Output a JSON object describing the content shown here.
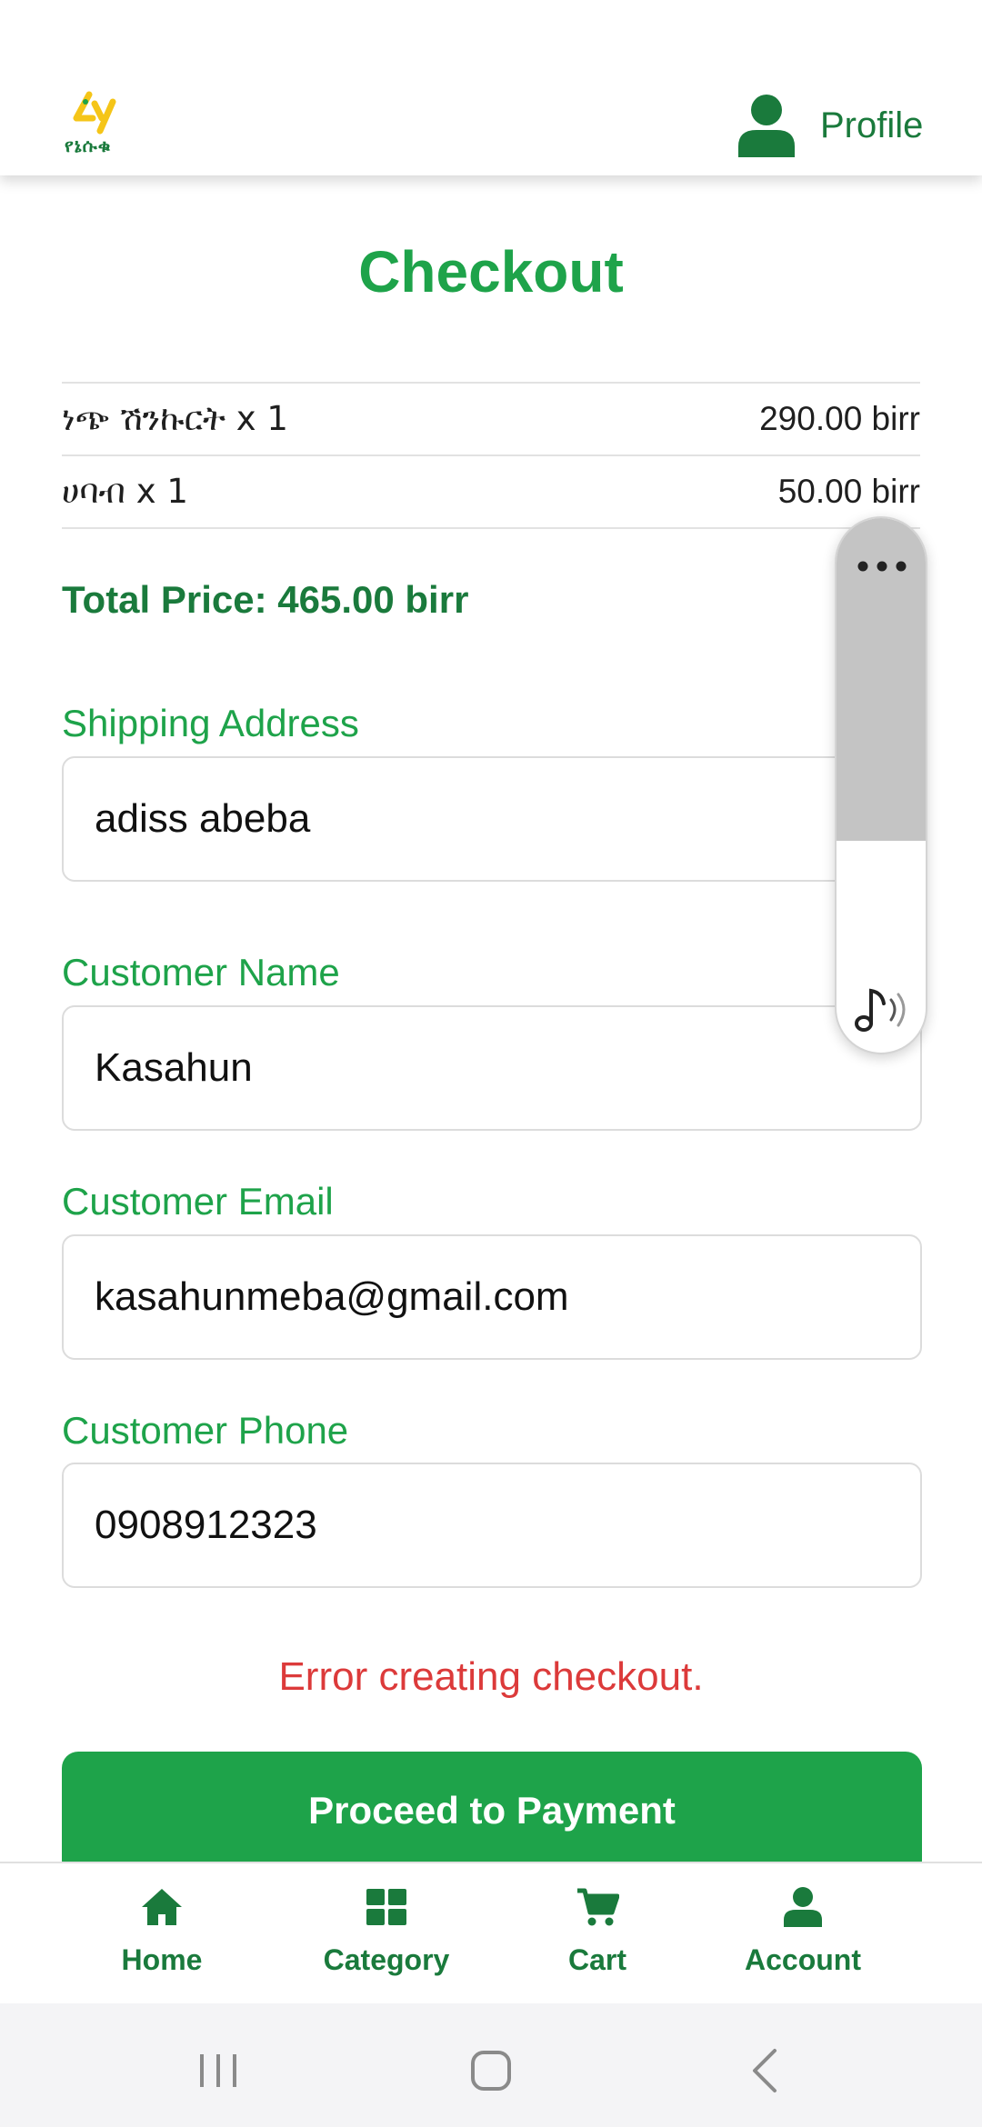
{
  "header": {
    "logo_text": "የኔሱቁ",
    "profile_label": "Profile"
  },
  "checkout": {
    "title": "Checkout",
    "items": [
      {
        "name": "ነጭ ሽንኩርት x 1",
        "price": "290.00 birr"
      },
      {
        "name": "ሀባብ x 1",
        "price": "50.00 birr"
      }
    ],
    "total": "Total Price: 465.00 birr"
  },
  "form": {
    "shipping_label": "Shipping Address",
    "shipping_value": "adiss abeba",
    "name_label": "Customer Name",
    "name_value": "Kasahun",
    "email_label": "Customer Email",
    "email_value": "kasahunmeba@gmail.com",
    "phone_label": "Customer Phone",
    "phone_value": "0908912323"
  },
  "error_message": "Error creating checkout.",
  "pay_button": "Proceed to Payment",
  "nav": {
    "home": "Home",
    "category": "Category",
    "cart": "Cart",
    "account": "Account"
  },
  "colors": {
    "primary_green": "#1ea34a",
    "dark_green": "#1a7a3c",
    "error_red": "#dc3a3a",
    "logo_yellow": "#f5c518"
  },
  "icons": {
    "profile": "person-icon",
    "home": "home-icon",
    "category": "grid-icon",
    "cart": "cart-icon",
    "account": "person-icon",
    "float_menu": "more-dots-icon",
    "float_sound": "music-note-icon"
  }
}
